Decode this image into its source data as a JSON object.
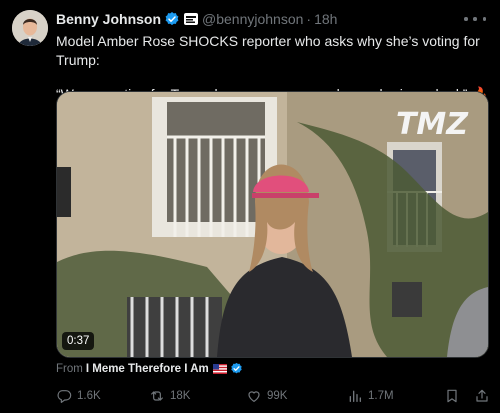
{
  "author": {
    "display_name": "Benny Johnson",
    "handle": "@bennyjohnson",
    "separator": "·",
    "time": "18h"
  },
  "tweet": {
    "line1": "Model Amber Rose SHOCKS reporter who asks why she’s voting for Trump:",
    "line2": "“We are voting for Trump because we are no longer brainwashed.” 🔥"
  },
  "media": {
    "watermark": "TMZ",
    "duration": "0:37"
  },
  "source": {
    "prefix": "From",
    "name": "I Meme Therefore I Am"
  },
  "actions": {
    "replies": "1.6K",
    "retweets": "18K",
    "likes": "99K",
    "views": "1.7M"
  },
  "colors": {
    "background": "#000000",
    "text": "#e7e9ea",
    "muted": "#71767b",
    "verified": "#1d9bf0"
  },
  "icons": [
    "verified-badge-icon",
    "more-icon",
    "reply-icon",
    "retweet-icon",
    "like-icon",
    "views-icon",
    "bookmark-icon",
    "share-icon",
    "us-flag-icon"
  ]
}
